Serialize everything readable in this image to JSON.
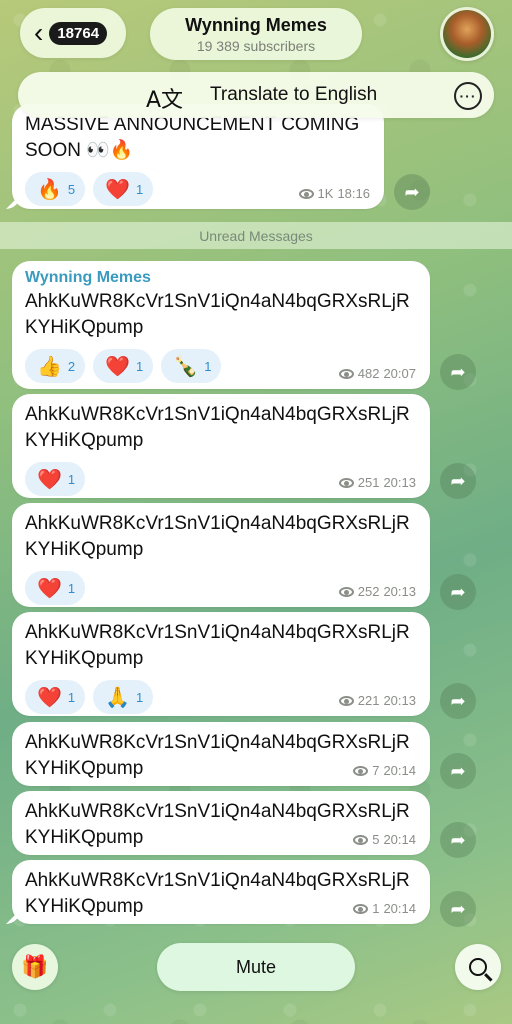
{
  "header": {
    "back_count": "18764",
    "channel_name": "Wynning Memes",
    "subscribers": "19 389 subscribers"
  },
  "translate_bar": {
    "label": "Translate to English",
    "icon": "translate-icon"
  },
  "pinned_message": {
    "text_line1": "MASSIVE ANNOUNCEMENT COMING",
    "text_line2": "SOON 👀🔥",
    "reactions": [
      {
        "emoji": "🔥",
        "count": "5"
      },
      {
        "emoji": "❤️",
        "count": "1"
      }
    ],
    "views": "1K",
    "time": "18:16"
  },
  "unread_label": "Unread Messages",
  "messages": [
    {
      "author": "Wynning Memes",
      "text": "AhkKuWR8KcVr1SnV1iQn4aN4bqGRXsRLjRKYHiKQpump",
      "reactions": [
        {
          "emoji": "👍",
          "count": "2"
        },
        {
          "emoji": "❤️",
          "count": "1"
        },
        {
          "emoji": "🍾",
          "count": "1"
        }
      ],
      "views": "482",
      "time": "20:07"
    },
    {
      "text": "AhkKuWR8KcVr1SnV1iQn4aN4bqGRXsRLjRKYHiKQpump",
      "reactions": [
        {
          "emoji": "❤️",
          "count": "1"
        }
      ],
      "views": "251",
      "time": "20:13"
    },
    {
      "text": "AhkKuWR8KcVr1SnV1iQn4aN4bqGRXsRLjRKYHiKQpump",
      "reactions": [
        {
          "emoji": "❤️",
          "count": "1"
        }
      ],
      "views": "252",
      "time": "20:13"
    },
    {
      "text": "AhkKuWR8KcVr1SnV1iQn4aN4bqGRXsRLjRKYHiKQpump",
      "reactions": [
        {
          "emoji": "❤️",
          "count": "1"
        },
        {
          "emoji": "🙏",
          "count": "1"
        }
      ],
      "views": "221",
      "time": "20:13"
    },
    {
      "text": "AhkKuWR8KcVr1SnV1iQn4aN4bqGRXsRLjRKYHiKQpump",
      "views": "7",
      "time": "20:14"
    },
    {
      "text": "AhkKuWR8KcVr1SnV1iQn4aN4bqGRXsRLjRKYHiKQpump",
      "views": "5",
      "time": "20:14"
    },
    {
      "text": "AhkKuWR8KcVr1SnV1iQn4aN4bqGRXsRLjRKYHiKQpump",
      "views": "1",
      "time": "20:14"
    }
  ],
  "bottom_bar": {
    "mute_label": "Mute",
    "gift_icon": "gift-icon",
    "search_icon": "search-icon"
  },
  "colors": {
    "author": "#3a9bbf",
    "reaction_bg": "#e4f0fa",
    "reaction_count": "#2f8ecf"
  }
}
